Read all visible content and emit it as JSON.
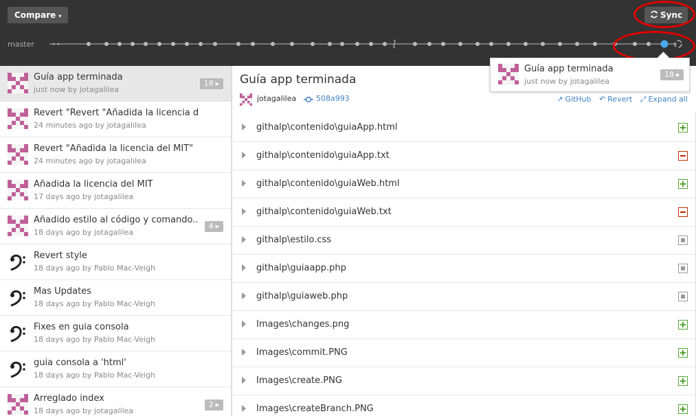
{
  "toolbar": {
    "compare_label": "Compare",
    "compare_caret": "▾",
    "sync_label": "Sync",
    "branch": "master"
  },
  "tooltip": {
    "title": "Guía app terminada",
    "meta": "just now by jotagalilea",
    "count": "18"
  },
  "commits": [
    {
      "title": "Guía app terminada",
      "meta": "just now by jotagalilea",
      "avatar": "jotagalilea",
      "count": "18",
      "selected": true
    },
    {
      "title": "Revert \"Revert \"Añadida la licencia del MIT\"\"",
      "meta": "24 minutes ago by jotagalilea",
      "avatar": "jotagalilea",
      "count": ""
    },
    {
      "title": "Revert \"Añadida la licencia del MIT\"",
      "meta": "24 minutes ago by jotagalilea",
      "avatar": "jotagalilea",
      "count": ""
    },
    {
      "title": "Añadida la licencia del MIT",
      "meta": "17 days ago by jotagalilea",
      "avatar": "jotagalilea",
      "count": ""
    },
    {
      "title": "Añadido estilo al código y comando...",
      "meta": "18 days ago by jotagalilea",
      "avatar": "jotagalilea",
      "count": "4"
    },
    {
      "title": "Revert style",
      "meta": "18 days ago by Pablo Mac-Veigh",
      "avatar": "bassclef",
      "count": ""
    },
    {
      "title": "Mas Updates",
      "meta": "18 days ago by Pablo Mac-Veigh",
      "avatar": "bassclef",
      "count": ""
    },
    {
      "title": "Fixes en guia consola",
      "meta": "18 days ago by Pablo Mac-Veigh",
      "avatar": "bassclef",
      "count": ""
    },
    {
      "title": "guia consola a 'html'",
      "meta": "18 days ago by Pablo Mac-Veigh",
      "avatar": "bassclef",
      "count": ""
    },
    {
      "title": "Arreglado index",
      "meta": "18 days ago by jotagalilea",
      "avatar": "jotagalilea",
      "count": "2"
    }
  ],
  "detail": {
    "title": "Guía app terminada",
    "author": "jotagalilea",
    "sha": "508a993",
    "actions": {
      "github": "GitHub",
      "revert": "Revert",
      "expand": "Expand all"
    }
  },
  "files": [
    {
      "path": "githalp\\contenido\\guiaApp.html",
      "status": "added"
    },
    {
      "path": "githalp\\contenido\\guiaApp.txt",
      "status": "removed"
    },
    {
      "path": "githalp\\contenido\\guiaWeb.html",
      "status": "added"
    },
    {
      "path": "githalp\\contenido\\guiaWeb.txt",
      "status": "removed"
    },
    {
      "path": "githalp\\estilo.css",
      "status": "modified"
    },
    {
      "path": "githalp\\guiaapp.php",
      "status": "modified"
    },
    {
      "path": "githalp\\guiaweb.php",
      "status": "modified"
    },
    {
      "path": "Images\\changes.png",
      "status": "added"
    },
    {
      "path": "Images\\commit.PNG",
      "status": "added"
    },
    {
      "path": "Images\\create.PNG",
      "status": "added"
    },
    {
      "path": "Images\\createBranch.PNG",
      "status": "added"
    }
  ],
  "colors": {
    "topbar": "#333333",
    "accent": "#4183c4",
    "added": "#55a532",
    "removed": "#bd2c00",
    "annotation": "#e00000",
    "avatar_pink": "#c0609a"
  }
}
